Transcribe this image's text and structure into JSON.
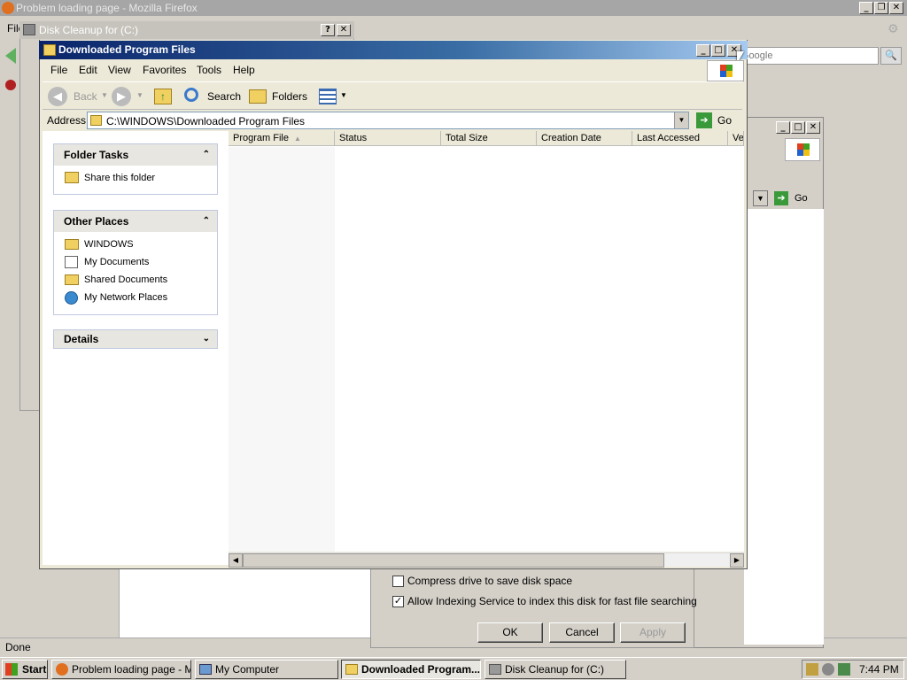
{
  "firefox": {
    "title": "Problem loading page - Mozilla Firefox",
    "menu_file": "File",
    "search_placeholder": "Google",
    "status": "Done"
  },
  "disk_cleanup": {
    "title": "Disk Cleanup for  (C:)",
    "compress_label": "Compress drive to save disk space",
    "compress_checked": false,
    "indexing_label": "Allow Indexing Service to index this disk for fast file searching",
    "indexing_checked": true,
    "ok_label": "OK",
    "cancel_label": "Cancel",
    "apply_label": "Apply"
  },
  "my_computer": {
    "go_label": "Go"
  },
  "explorer": {
    "title": "Downloaded Program Files",
    "menu": [
      "File",
      "Edit",
      "View",
      "Favorites",
      "Tools",
      "Help"
    ],
    "toolbar": {
      "back": "Back",
      "search": "Search",
      "folders": "Folders"
    },
    "address_label": "Address",
    "address_value": "C:\\WINDOWS\\Downloaded Program Files",
    "go_label": "Go",
    "folder_tasks": {
      "title": "Folder Tasks",
      "items": [
        "Share this folder"
      ]
    },
    "other_places": {
      "title": "Other Places",
      "items": [
        "WINDOWS",
        "My Documents",
        "Shared Documents",
        "My Network Places"
      ]
    },
    "details": {
      "title": "Details"
    },
    "columns": [
      "Program File",
      "Status",
      "Total Size",
      "Creation Date",
      "Last Accessed",
      "Ve"
    ]
  },
  "taskbar": {
    "start": "Start",
    "tasks": [
      "Problem loading page - M...",
      "My Computer",
      "Downloaded Program...",
      "Disk Cleanup for  (C:)"
    ],
    "clock": "7:44 PM"
  },
  "colors": {
    "title_active": "#0a246a",
    "title_inactive": "#a6a6a6",
    "face": "#d4d0c8"
  }
}
